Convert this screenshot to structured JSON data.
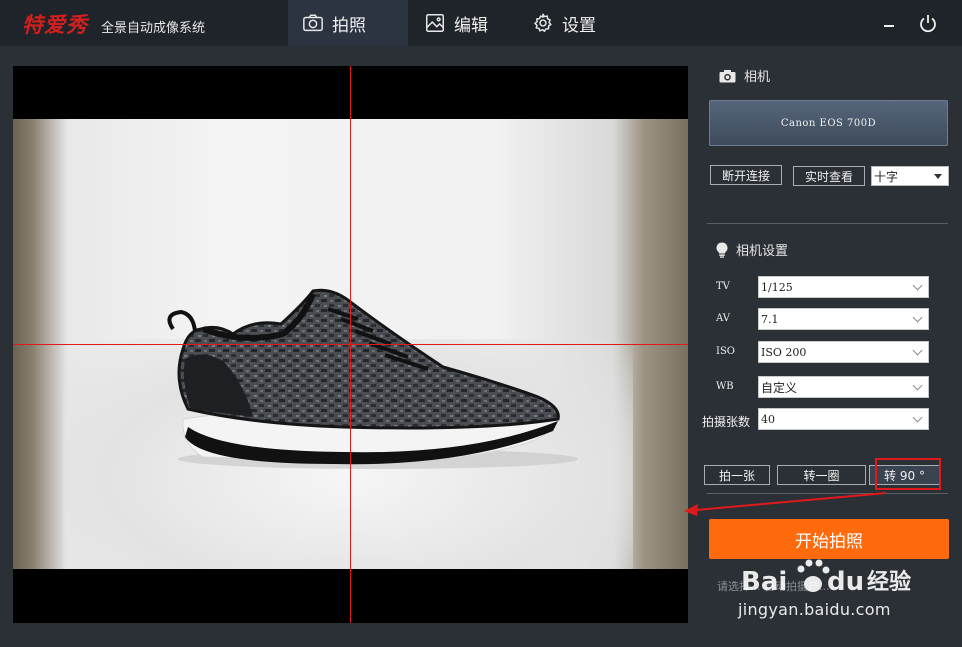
{
  "app": {
    "logo": "特爱秀",
    "subtitle": "全景自动成像系统"
  },
  "nav": {
    "tabs": [
      {
        "label": "拍照",
        "icon": "camera-icon",
        "active": true
      },
      {
        "label": "编辑",
        "icon": "image-icon",
        "active": false
      },
      {
        "label": "设置",
        "icon": "gear-icon",
        "active": false
      }
    ]
  },
  "window": {
    "minimize_icon": "minimize-icon",
    "power_icon": "power-icon"
  },
  "camera": {
    "section_title": "相机",
    "model": "Canon EOS 700D",
    "disconnect_label": "断开连接",
    "liveview_label": "实时查看",
    "overlay_select": "十字"
  },
  "settings": {
    "section_title": "相机设置",
    "rows": [
      {
        "label": "TV",
        "value": "1/125"
      },
      {
        "label": "AV",
        "value": "7.1"
      },
      {
        "label": "ISO",
        "value": "ISO 200"
      },
      {
        "label": "WB",
        "value": "自定义"
      },
      {
        "label": "拍摄张数",
        "value": "40"
      }
    ]
  },
  "actions": {
    "shoot_one": "拍一张",
    "rotate_full": "转一圈",
    "rotate_90": "转 90 °",
    "start": "开始拍照",
    "hint": "请选择...                自动拍摄产..."
  },
  "watermark": {
    "brand": "Bai du 经验",
    "url": "jingyan.baidu.com"
  },
  "colors": {
    "accent": "#ff6a0d",
    "crosshair": "#e0191a",
    "background": "#2b2f36",
    "titlebar": "#1f232a"
  }
}
